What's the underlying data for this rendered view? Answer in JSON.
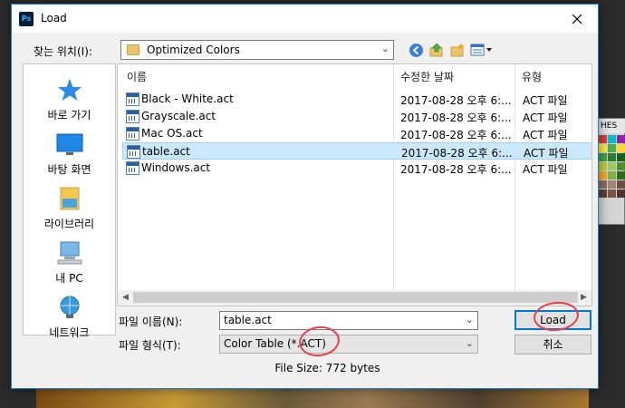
{
  "window": {
    "app_icon_text": "Ps",
    "title": "Load"
  },
  "toolbar": {
    "look_in_label": "찾는 위치(I):",
    "look_in_value": "Optimized Colors"
  },
  "places": [
    {
      "label": "바로 가기"
    },
    {
      "label": "바탕 화면"
    },
    {
      "label": "라이브러리"
    },
    {
      "label": "내 PC"
    },
    {
      "label": "네트워크"
    }
  ],
  "file_list": {
    "columns": [
      "이름",
      "수정한 날짜",
      "유형"
    ],
    "rows": [
      {
        "name": "Black - White.act",
        "date": "2017-08-28 오후 6:...",
        "type": "ACT 파일"
      },
      {
        "name": "Grayscale.act",
        "date": "2017-08-28 오후 6:...",
        "type": "ACT 파일"
      },
      {
        "name": "Mac OS.act",
        "date": "2017-08-28 오후 6:...",
        "type": "ACT 파일"
      },
      {
        "name": "table.act",
        "date": "2017-08-28 오후 6:...",
        "type": "ACT 파일"
      },
      {
        "name": "Windows.act",
        "date": "2017-08-28 오후 6:...",
        "type": "ACT 파일"
      }
    ],
    "selected_index": 3
  },
  "form": {
    "filename_label": "파일 이름(N):",
    "filename_value": "table.act",
    "filetype_label": "파일 형식(T):",
    "filetype_value": "Color Table (*.ACT)",
    "file_size": "File Size: 772 bytes"
  },
  "buttons": {
    "load": "Load",
    "cancel": "취소"
  },
  "background": {
    "swatches_tab": "HES"
  },
  "colors": {
    "accent": "#0078d7",
    "selection": "#cce8ff",
    "annotation": "#e8404a"
  }
}
